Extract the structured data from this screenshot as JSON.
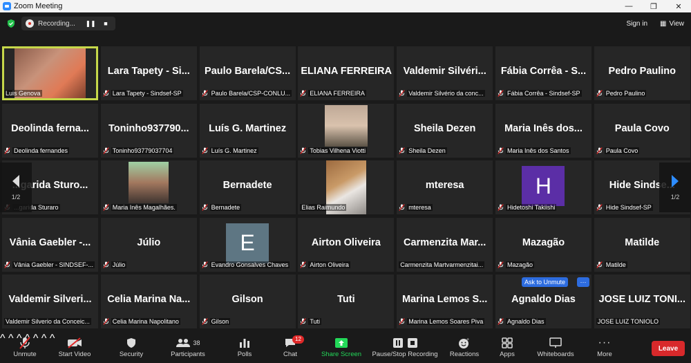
{
  "window": {
    "title": "Zoom Meeting"
  },
  "topbar": {
    "recording_label": "Recording...",
    "signin_label": "Sign in",
    "view_label": "View"
  },
  "page_indicator": "1/2",
  "tiles": [
    {
      "big": "",
      "label": "Luis Genova",
      "type": "video-luis",
      "mic_off": false,
      "active": true
    },
    {
      "big": "Lara Tapety - Si...",
      "label": "Lara Tapety - Sindsef-SP",
      "type": "name",
      "mic_off": true
    },
    {
      "big": "Paulo Barela/CS...",
      "label": "Paulo Barela/CSP-CONLU...",
      "type": "name",
      "mic_off": true
    },
    {
      "big": "ELIANA FERREIRA",
      "label": "ELIANA FERREIRA",
      "type": "name",
      "mic_off": true
    },
    {
      "big": "Valdemir Silvéri...",
      "label": "Valdemir Silvério da conc...",
      "type": "name",
      "mic_off": true
    },
    {
      "big": "Fábia Corrêa - S...",
      "label": "Fábia Corrêa - Sindsef-SP",
      "type": "name",
      "mic_off": true
    },
    {
      "big": "Pedro Paulino",
      "label": "Pedro Paulino",
      "type": "name",
      "mic_off": true
    },
    {
      "big": "Deolinda  ferna...",
      "label": "Deolinda  fernandes",
      "type": "name",
      "mic_off": true
    },
    {
      "big": "Toninho937790...",
      "label": "Toninho93779037704",
      "type": "name",
      "mic_off": true
    },
    {
      "big": "Luís G. Martinez",
      "label": "Luís G. Martinez",
      "type": "name",
      "mic_off": true
    },
    {
      "big": "",
      "label": "Tobias Vilhena Viotti",
      "type": "video-tobias",
      "mic_off": true
    },
    {
      "big": "Sheila Dezen",
      "label": "Sheila Dezen",
      "type": "name",
      "mic_off": true
    },
    {
      "big": "Maria Inês dos...",
      "label": "Maria Inês dos Santos",
      "type": "name",
      "mic_off": true
    },
    {
      "big": "Paula Covo",
      "label": "Paula Covo",
      "type": "name",
      "mic_off": true
    },
    {
      "big": "...garida Sturo...",
      "label": "...garida Sturaro",
      "type": "name",
      "mic_off": true
    },
    {
      "big": "",
      "label": "Maria Inês Magalhães.",
      "type": "video-maria",
      "mic_off": true
    },
    {
      "big": "Bernadete",
      "label": "Bernadete",
      "type": "name",
      "mic_off": true
    },
    {
      "big": "",
      "label": "Elias Raimundo",
      "type": "video-elias",
      "mic_off": false
    },
    {
      "big": "mteresa",
      "label": "mteresa",
      "type": "name",
      "mic_off": true
    },
    {
      "big": "",
      "label": "Hidetoshi Takiishi",
      "type": "avatar-h",
      "mic_off": true,
      "avatar": "H"
    },
    {
      "big": "Hide Sindse...",
      "label": "Hide Sindsef-SP",
      "type": "name",
      "mic_off": true
    },
    {
      "big": "Vânia Gaebler -...",
      "label": "Vânia Gaebler - SINDSEF-...",
      "type": "name",
      "mic_off": true
    },
    {
      "big": "Júlio",
      "label": "Júlio",
      "type": "name",
      "mic_off": true
    },
    {
      "big": "",
      "label": "Evandro Gonsalves Chaves",
      "type": "avatar-e",
      "mic_off": true,
      "avatar": "E"
    },
    {
      "big": "Airton Oliveira",
      "label": "Airton Oliveira",
      "type": "name",
      "mic_off": true
    },
    {
      "big": "Carmenzita  Mar...",
      "label": "Carmenzita Martvarmenzitai...",
      "type": "name",
      "mic_off": false
    },
    {
      "big": "Mazagão",
      "label": "Mazagão",
      "type": "name",
      "mic_off": true
    },
    {
      "big": "Matilde",
      "label": "Matilde",
      "type": "name",
      "mic_off": true
    },
    {
      "big": "Valdemir Silveri...",
      "label": "Valdemir Silverio da Conceic...",
      "type": "name",
      "mic_off": false
    },
    {
      "big": "Celia Marina Na...",
      "label": "Celia Marina Napolitano",
      "type": "name",
      "mic_off": true
    },
    {
      "big": "Gilson",
      "label": "Gilson",
      "type": "name",
      "mic_off": true
    },
    {
      "big": "Tuti",
      "label": "Tuti",
      "type": "name",
      "mic_off": true
    },
    {
      "big": "Marina Lemos S...",
      "label": "Marina Lemos Soares Piva",
      "type": "name",
      "mic_off": true
    },
    {
      "big": "Agnaldo Dias",
      "label": "Agnaldo Dias",
      "type": "name",
      "mic_off": true,
      "ask_unmute": "Ask to Unmute",
      "more": "···"
    },
    {
      "big": "JOSE LUIZ TONI...",
      "label": "JOSE LUIZ TONIOLO",
      "type": "name",
      "mic_off": false
    }
  ],
  "toolbar": {
    "unmute": "Unmute",
    "start_video": "Start Video",
    "security": "Security",
    "participants": "Participants",
    "participants_count": "38",
    "polls": "Polls",
    "chat": "Chat",
    "chat_badge": "12",
    "share_screen": "Share Screen",
    "pause_stop_recording": "Pause/Stop Recording",
    "reactions": "Reactions",
    "apps": "Apps",
    "whiteboards": "Whiteboards",
    "more": "More",
    "leave": "Leave"
  },
  "colors": {
    "share_green": "#23d959",
    "leave_red": "#d8292b",
    "active_border": "#c6d84a",
    "avatar_h": "#5b2ea6",
    "avatar_e": "#5e7683",
    "ask_blue": "#2d6cdf"
  }
}
